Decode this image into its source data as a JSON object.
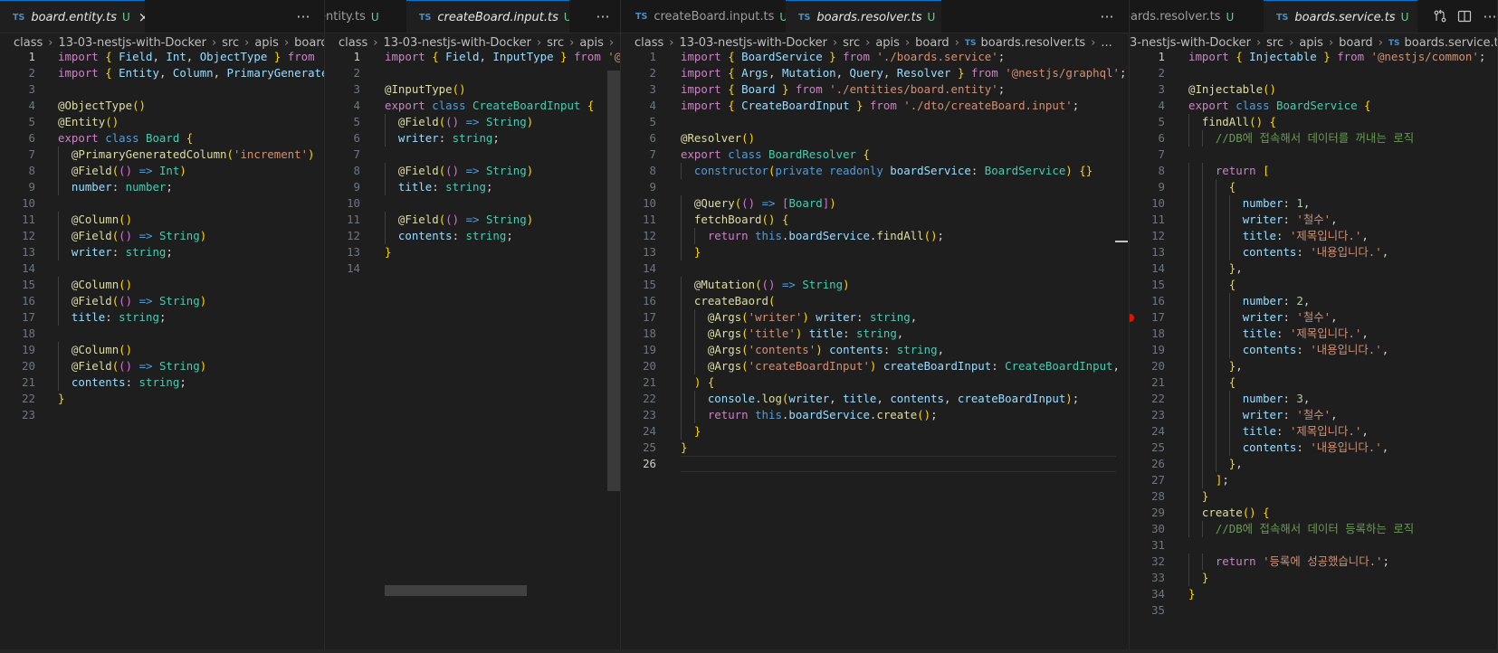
{
  "panes": [
    {
      "tabs": [
        {
          "name": "board.entity.ts",
          "status": "U",
          "active": true,
          "close": "×"
        }
      ],
      "breadcrumb": [
        "class",
        "13-03-nestjs-with-Docker",
        "src",
        "apis",
        "board"
      ],
      "breadcrumb_tail": "",
      "lines": [
        "import { Field, Int, ObjectType } from '@",
        "import { Entity, Column, PrimaryGenerated",
        "",
        "@ObjectType()",
        "@Entity()",
        "export class Board {",
        "  @PrimaryGeneratedColumn('increment')",
        "  @Field(() => Int)",
        "  number: number;",
        "",
        "  @Column()",
        "  @Field(() => String)",
        "  writer: string;",
        "",
        "  @Column()",
        "  @Field(() => String)",
        "  title: string;",
        "",
        "  @Column()",
        "  @Field(() => String)",
        "  contents: string;",
        "}",
        ""
      ],
      "current_line": 1
    },
    {
      "tabs": [
        {
          "name": "entity.ts",
          "status": "U",
          "active": false,
          "close": ""
        },
        {
          "name": "createBoard.input.ts",
          "status": "U",
          "active": true,
          "close": "×"
        }
      ],
      "breadcrumb": [
        "class",
        "13-03-nestjs-with-Docker",
        "src",
        "apis",
        "bo"
      ],
      "breadcrumb_tail": "",
      "lines": [
        "import { Field, InputType } from '@n",
        "",
        "@InputType()",
        "export class CreateBoardInput {",
        "  @Field(() => String)",
        "  writer: string;",
        "",
        "  @Field(() => String)",
        "  title: string;",
        "",
        "  @Field(() => String)",
        "  contents: string;",
        "}",
        ""
      ],
      "current_line": 1
    },
    {
      "tabs": [
        {
          "name": "createBoard.input.ts",
          "status": "U",
          "active": false,
          "close": ""
        },
        {
          "name": "boards.resolver.ts",
          "status": "U",
          "active": true,
          "close": "×"
        }
      ],
      "breadcrumb": [
        "class",
        "13-03-nestjs-with-Docker",
        "src",
        "apis",
        "board",
        "boards.resolver.ts",
        "..."
      ],
      "breadcrumb_tail": "",
      "lines": [
        "import { BoardService } from './boards.service';",
        "import { Args, Mutation, Query, Resolver } from '@nestjs/graphql';",
        "import { Board } from './entities/board.entity';",
        "import { CreateBoardInput } from './dto/createBoard.input';",
        "",
        "@Resolver()",
        "export class BoardResolver {",
        "  constructor(private readonly boardService: BoardService) {}",
        "",
        "  @Query(() => [Board])",
        "  fetchBoard() {",
        "    return this.boardService.findAll();",
        "  }",
        "",
        "  @Mutation(() => String)",
        "  createBaord(",
        "    @Args('writer') writer: string,",
        "    @Args('title') title: string,",
        "    @Args('contents') contents: string,",
        "    @Args('createBoardInput') createBoardInput: CreateBoardInput,",
        "  ) {",
        "    console.log(writer, title, contents, createBoardInput);",
        "    return this.boardService.create();",
        "  }",
        "}",
        ""
      ],
      "current_line": 26
    },
    {
      "tabs": [
        {
          "name": "boards.resolver.ts",
          "status": "U",
          "active": false,
          "close": ""
        },
        {
          "name": "boards.service.ts",
          "status": "U",
          "active": true,
          "close": "×"
        }
      ],
      "breadcrumb": [
        "3-nestjs-with-Docker",
        "src",
        "apis",
        "board",
        "boards.service.ts"
      ],
      "breadcrumb_tail": "",
      "lines": [
        "import { Injectable } from '@nestjs/common';",
        "",
        "@Injectable()",
        "export class BoardService {",
        "  findAll() {",
        "    //DB에 접속해서 데이터를 꺼내는 로직",
        "",
        "    return [",
        "      {",
        "        number: 1,",
        "        writer: '철수',",
        "        title: '제목입니다.',",
        "        contents: '내용입니다.',",
        "      },",
        "      {",
        "        number: 2,",
        "        writer: '철수',",
        "        title: '제목입니다.',",
        "        contents: '내용입니다.',",
        "      },",
        "      {",
        "        number: 3,",
        "        writer: '철수',",
        "        title: '제목입니다.',",
        "        contents: '내용입니다.',",
        "      },",
        "    ];",
        "  }",
        "  create() {",
        "    //DB에 접속해서 데이터 등록하는 로직",
        "",
        "    return '등록에 성공했습니다.';",
        "  }",
        "}",
        ""
      ],
      "current_line": 1,
      "breakpoint_line": 17
    }
  ],
  "more_label": "···",
  "icons": {
    "ts": "TS",
    "compare": "git-compare-icon",
    "split": "split-editor-icon"
  },
  "colors": {
    "bg": "#1e1e1e",
    "keyword": "#c586c0",
    "string": "#ce9178",
    "type": "#4ec9b0",
    "variable": "#9cdcfe",
    "function": "#dcdcaa",
    "comment": "#6a9955",
    "modified": "#73c991"
  }
}
